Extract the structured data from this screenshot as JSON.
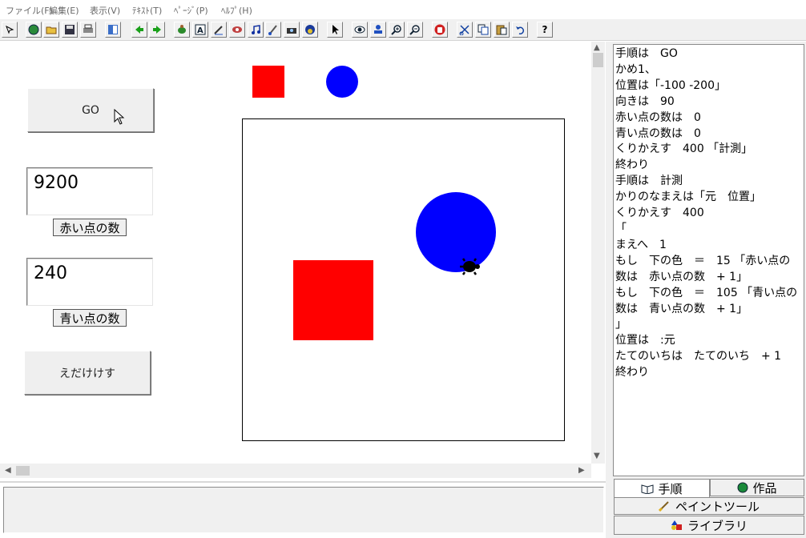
{
  "menu": [
    "ファイル(F)",
    "編集(E)",
    "表示(V)",
    "ﾃｷｽﾄ(T)",
    "ﾍﾟｰｼﾞ(P)",
    "ﾍﾙﾌﾟ(H)"
  ],
  "toolbar": {
    "icons": [
      "select-mode-icon",
      "globe-icon",
      "open-folder-icon",
      "save-icon",
      "print-icon",
      "panel-icon",
      "back-arrow-icon",
      "forward-arrow-icon",
      "turtle-icon",
      "text-box-icon",
      "pen-icon",
      "eye-button-icon",
      "music-icon",
      "paint-icon",
      "camera-icon",
      "photo-icon",
      "pointer-icon",
      "view-icon",
      "stamp-icon",
      "zoom-in-icon",
      "zoom-out-icon",
      "stop-hand-icon",
      "cut-icon",
      "copy-icon",
      "paste-icon",
      "undo-icon",
      "help-icon"
    ],
    "help_label": "?"
  },
  "buttons": {
    "go": "GO",
    "erase": "えだけけす"
  },
  "counters": {
    "red": {
      "value": "9200",
      "label": "赤い点の数"
    },
    "blue": {
      "value": "240",
      "label": "青い点の数"
    }
  },
  "colors": {
    "red": "#ff0000",
    "blue": "#0000ff",
    "turtle": "#000000"
  },
  "script_lines": [
    "手順は　GO",
    "かめ1、",
    "位置は「-100 -200」",
    "向きは　90",
    "赤い点の数は　0",
    "青い点の数は　0",
    "くりかえす　400 「計測」",
    "終わり",
    "手順は　計測",
    "かりのなまえは「元　位置」",
    "くりかえす　400",
    "「",
    "まえへ　1",
    "もし　下の色　＝　15 「赤い点の",
    "数は　赤い点の数　+ 1」",
    "もし　下の色　＝　105 「青い点の",
    "数は　青い点の数　+ 1」",
    "」",
    "位置は　:元",
    "たてのいちは　たてのいち　+ 1",
    "終わり"
  ],
  "tabs": {
    "procedure": "手順",
    "work": "作品",
    "paint": "ペイントツール",
    "library": "ライブラリ"
  }
}
